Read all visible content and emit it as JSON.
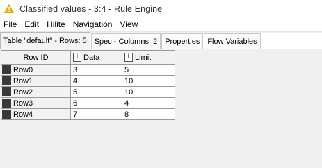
{
  "window": {
    "title": "Classified values - 3:4 - Rule Engine",
    "icon": "warning-triangle-icon",
    "icon_color": "#f5b800"
  },
  "menu": [
    {
      "label": "File",
      "mnemonic": "F",
      "rest": "ile"
    },
    {
      "label": "Edit",
      "mnemonic": "E",
      "rest": "dit"
    },
    {
      "label": "Hilite",
      "mnemonic": "H",
      "rest": "ilite"
    },
    {
      "label": "Navigation",
      "mnemonic": "N",
      "rest": "avigation"
    },
    {
      "label": "View",
      "mnemonic": "V",
      "rest": "iew"
    }
  ],
  "tabs": [
    {
      "label": "Table \"default\" - Rows: 5",
      "active": true
    },
    {
      "label": "Spec - Columns: 2",
      "active": false
    },
    {
      "label": "Properties",
      "active": false
    },
    {
      "label": "Flow Variables",
      "active": false
    }
  ],
  "table": {
    "columns": [
      {
        "label": "Row ID",
        "type_icon": ""
      },
      {
        "label": "Data",
        "type_icon": "I"
      },
      {
        "label": "Limit",
        "type_icon": "I"
      }
    ],
    "rows": [
      {
        "id": "Row0",
        "data": "3",
        "limit": "5"
      },
      {
        "id": "Row1",
        "data": "4",
        "limit": "10"
      },
      {
        "id": "Row2",
        "data": "5",
        "limit": "10"
      },
      {
        "id": "Row3",
        "data": "6",
        "limit": "4"
      },
      {
        "id": "Row4",
        "data": "7",
        "limit": "8"
      }
    ]
  }
}
